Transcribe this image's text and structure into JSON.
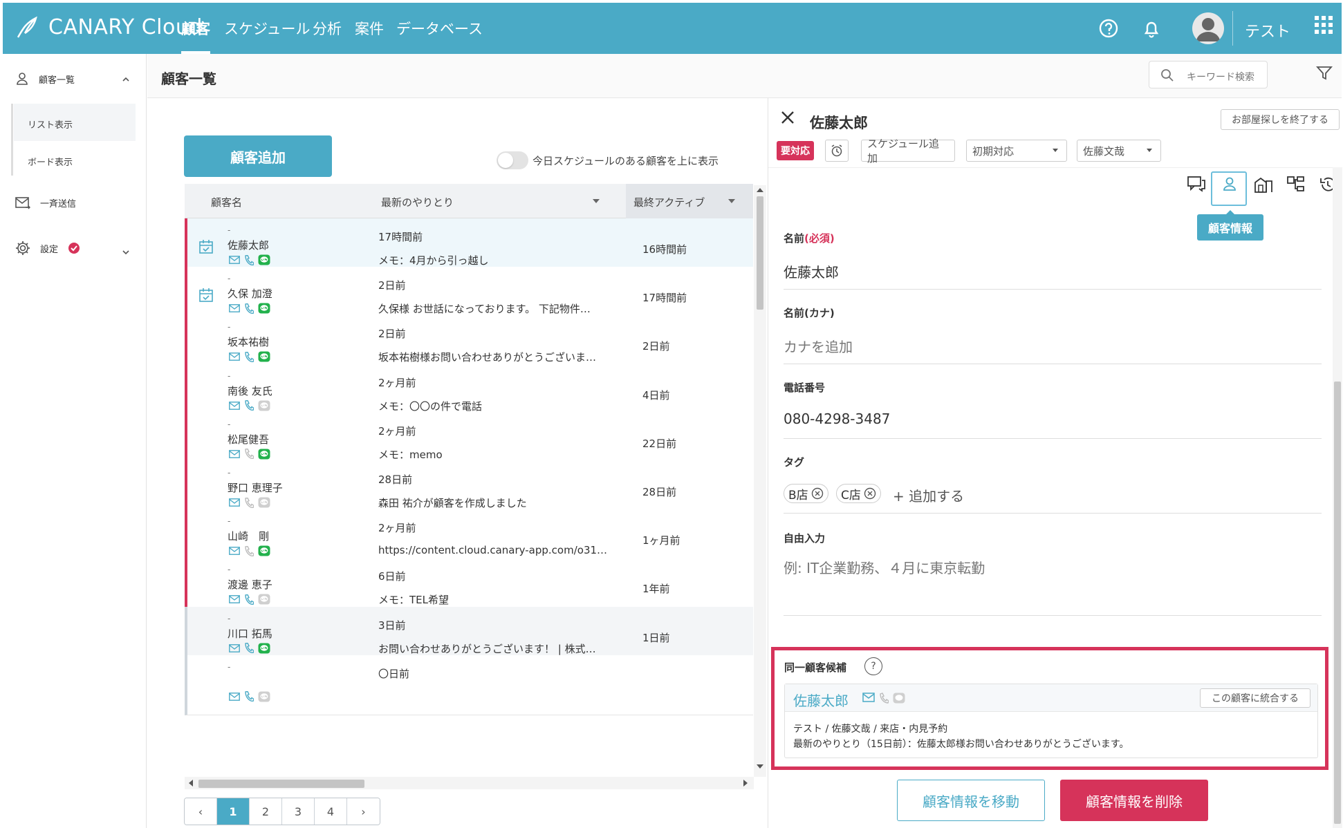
{
  "header": {
    "logo_text": "CANARY Cloud",
    "nav": [
      "顧客",
      "スケジュール",
      "分析",
      "案件",
      "データベース"
    ],
    "active_nav": "顧客",
    "user_name": "テスト"
  },
  "sidebar": {
    "customer_list": "顧客一覧",
    "list_view": "リスト表示",
    "board_view": "ボード表示",
    "bulk_send": "一斉送信",
    "settings": "設定"
  },
  "topbar": {
    "title": "顧客一覧",
    "search_placeholder": "キーワード検索"
  },
  "list": {
    "add_button": "顧客追加",
    "toggle_label": "今日スケジュールのある顧客を上に表示",
    "columns": [
      "顧客名",
      "最新のやりとり",
      "最終アクティブ"
    ],
    "rows": [
      {
        "dash": "-",
        "name": "佐藤太郎",
        "time": "17時間前",
        "message": "メモ：4月から引っ越し",
        "last_active": "16時間前"
      },
      {
        "dash": "-",
        "name": "久保 加澄",
        "time": "2日前",
        "message": "久保様 お世話になっております。 下記物件…",
        "last_active": "17時間前"
      },
      {
        "dash": "-",
        "name": "坂本祐樹",
        "time": "2日前",
        "message": "坂本祐樹様お問い合わせありがとうございま…",
        "last_active": "2日前"
      },
      {
        "dash": "-",
        "name": "南後 友氏",
        "time": "2ヶ月前",
        "message": "メモ：〇〇の件で電話",
        "last_active": "4日前"
      },
      {
        "dash": "-",
        "name": "松尾健吾",
        "time": "2ヶ月前",
        "message": "メモ：memo",
        "last_active": "22日前"
      },
      {
        "dash": "-",
        "name": "野口 恵理子",
        "time": "28日前",
        "message": "森田 祐介が顧客を作成しました",
        "last_active": "28日前"
      },
      {
        "dash": "-",
        "name": "山崎　剛",
        "time": "2ヶ月前",
        "message": "https://content.cloud.canary-app.com/o31…",
        "last_active": "1ヶ月前"
      },
      {
        "dash": "-",
        "name": "渡邊 恵子",
        "time": "6日前",
        "message": "メモ：TEL希望",
        "last_active": "1年前"
      },
      {
        "dash": "-",
        "name": "川口 拓馬",
        "time": "3日前",
        "message": "お問い合わせありがとうございます！ | 株式…",
        "last_active": "1日前"
      },
      {
        "dash": "-",
        "name": "",
        "time": "〇日前",
        "message": "",
        "last_active": ""
      }
    ],
    "pagination": [
      "‹",
      "1",
      "2",
      "3",
      "4",
      "›"
    ],
    "current_page": "1"
  },
  "detail": {
    "customer_name": "佐藤太郎",
    "end_room_search": "お部屋探しを終了する",
    "status_badge": "要対応",
    "schedule_add": "スケジュール追加",
    "stage": "初期対応",
    "assignee": "佐藤文哉",
    "tooltip": "顧客情報",
    "fields": {
      "name_label": "名前",
      "required": "(必須)",
      "name_value": "佐藤太郎",
      "kana_label": "名前(カナ)",
      "kana_placeholder": "カナを追加",
      "phone_label": "電話番号",
      "phone_value": "080-4298-3487",
      "tag_label": "タグ",
      "tags": [
        "B店",
        "C店"
      ],
      "tag_add": "追加する",
      "free_label": "自由入力",
      "free_placeholder": "例: IT企業勤務、４月に東京転勤"
    },
    "duplicate": {
      "title": "同一顧客候補",
      "help": "?",
      "name": "佐藤太郎",
      "merge_button": "この顧客に統合する",
      "info_line": "テスト / 佐藤文哉 / 来店・内見予約",
      "latest_line": "最新のやりとり（15日前）：佐藤太郎様お問い合わせありがとうございます。"
    },
    "move_button": "顧客情報を移動",
    "delete_button": "顧客情報を削除"
  },
  "colors": {
    "brand": "#4aaac6",
    "danger": "#d6335a",
    "line_green": "#22b14c"
  }
}
